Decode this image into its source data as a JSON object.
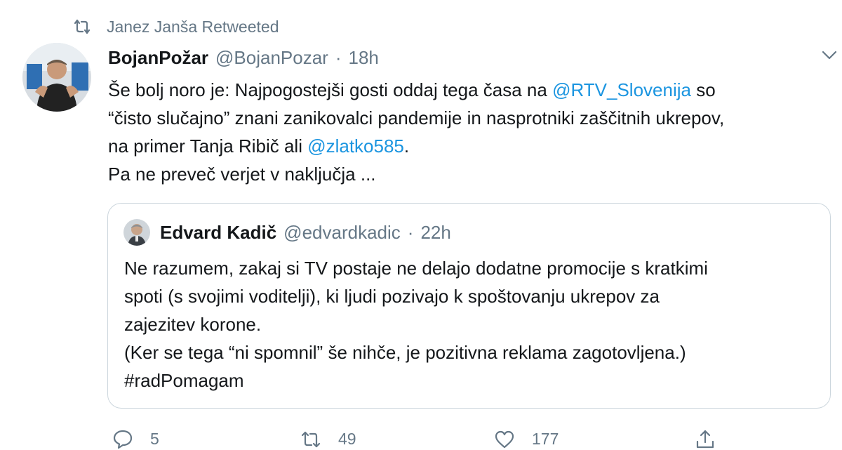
{
  "retweet_context": {
    "icon": "retweet-icon",
    "text": "Janez Janša Retweeted"
  },
  "tweet": {
    "author_name": "BojanPožar",
    "author_handle": "@BojanPozar",
    "separator": "·",
    "time": "18h",
    "body": {
      "line1_text": "Še bolj noro je: Najpogostejši gosti oddaj tega časa na ",
      "line1_mention": "@RTV_Slovenija",
      "line1_tail": " so",
      "line2": "“čisto slučajno” znani zanikovalci pandemije in nasprotniki zaščitnih ukrepov,",
      "line3_text": "na primer Tanja Ribič ali ",
      "line3_mention": "@zlatko585",
      "line3_tail": ".",
      "line4": "Pa ne preveč verjet v naključja ..."
    }
  },
  "quoted_tweet": {
    "author_name": "Edvard Kadič",
    "author_handle": "@edvardkadic",
    "separator": "·",
    "time": "22h",
    "lines": [
      "Ne razumem, zakaj si TV postaje ne delajo dodatne promocije s kratkimi",
      "spoti (s svojimi voditelji), ki ljudi pozivajo k spoštovanju ukrepov za",
      "zajezitev korone.",
      "(Ker se tega “ni spomnil” še nihče, je pozitivna reklama zagotovljena.)",
      "#radPomagam"
    ]
  },
  "actions": {
    "reply": {
      "icon": "reply-icon",
      "count": "5"
    },
    "retweet": {
      "icon": "retweet-icon",
      "count": "49"
    },
    "like": {
      "icon": "heart-icon",
      "count": "177"
    },
    "share": {
      "icon": "share-icon"
    }
  },
  "colors": {
    "text": "#14171a",
    "secondary": "#657786",
    "link": "#1b95e0",
    "border": "#ccd6dd"
  }
}
